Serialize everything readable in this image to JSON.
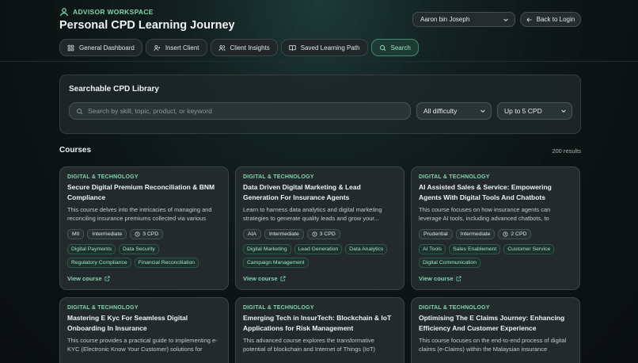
{
  "header": {
    "workspace_label": "ADVISOR WORKSPACE",
    "title": "Personal CPD Learning Journey",
    "user_select": "Aaron bin Joseph",
    "back_label": "Back to Login",
    "nav": [
      {
        "label": "General Dashboard",
        "icon": "grid-icon",
        "active": false
      },
      {
        "label": "Insert Client",
        "icon": "user-plus-icon",
        "active": false
      },
      {
        "label": "Client Insights",
        "icon": "users-icon",
        "active": false
      },
      {
        "label": "Saved Learning Path",
        "icon": "book-open-icon",
        "active": false
      },
      {
        "label": "Search",
        "icon": "search-icon",
        "active": true
      }
    ]
  },
  "library": {
    "title": "Searchable CPD Library",
    "search_placeholder": "Search by skill, topic, product, or keyword",
    "search_value": "",
    "difficulty": "All difficulty",
    "cpd_filter": "Up to 5 CPD"
  },
  "courses": {
    "title": "Courses",
    "results": "200 results",
    "view_label": "View course",
    "items": [
      {
        "category": "DIGITAL & TECHNOLOGY",
        "title": "Secure Digital Premium Reconciliation & BNM Compliance",
        "description": "This course delves into the intricacies of managing and reconciling insurance premiums collected via various digit...",
        "provider": "MII",
        "level": "Intermediate",
        "cpd": "3 CPD",
        "tags": [
          "Digital Payments",
          "Data Security",
          "Regulatory Compliance",
          "Financial Reconciliation"
        ]
      },
      {
        "category": "DIGITAL & TECHNOLOGY",
        "title": "Data Driven Digital Marketing & Lead Generation For Insurance Agents",
        "description": "Learn to harness data analytics and digital marketing strategies to generate quality leads and grow your...",
        "provider": "AIA",
        "level": "Intermediate",
        "cpd": "3 CPD",
        "tags": [
          "Digital Marketing",
          "Lead Generation",
          "Data Analytics",
          "Campaign Management"
        ]
      },
      {
        "category": "DIGITAL & TECHNOLOGY",
        "title": "AI Assisted Sales & Service: Empowering Agents With Digital Tools And Chatbots",
        "description": "This course focuses on how insurance agents can leverage AI tools, including advanced chatbots, to enhance their...",
        "provider": "Prudential",
        "level": "Intermediate",
        "cpd": "2 CPD",
        "tags": [
          "AI Tools",
          "Sales Enablement",
          "Customer Service",
          "Digital Communication"
        ]
      },
      {
        "category": "DIGITAL & TECHNOLOGY",
        "title": "Mastering E Kyc For Seamless Digital Onboarding In Insurance",
        "description": "This course provides a practical guide to implementing e-KYC (Electronic Know Your Customer) solutions for digital...",
        "provider": "",
        "level": "",
        "cpd": "",
        "tags": []
      },
      {
        "category": "DIGITAL & TECHNOLOGY",
        "title": "Emerging Tech in InsurTech: Blockchain & IoT Applications for Risk Management",
        "description": "This advanced course explores the transformative potential of blockchain and Internet of Things (IoT) technologies...",
        "provider": "",
        "level": "",
        "cpd": "",
        "tags": []
      },
      {
        "category": "DIGITAL & TECHNOLOGY",
        "title": "Optimising The E Claims Journey: Enhancing Efficiency And Customer Experience",
        "description": "This course focuses on the end-to-end process of digital claims (e-Claims) within the Malaysian insurance context....",
        "provider": "",
        "level": "",
        "cpd": "",
        "tags": []
      }
    ]
  },
  "colors": {
    "accent": "#7fd6ae",
    "card_bg": "#222a2b",
    "page_bg": "#0d1414"
  }
}
